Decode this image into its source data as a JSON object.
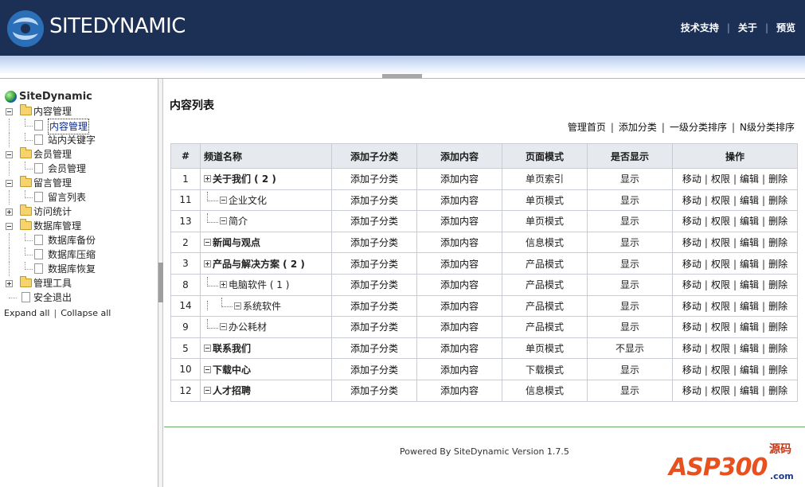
{
  "header": {
    "brand": "SITEDYNAMIC",
    "nav": [
      "技术支持",
      "关于",
      "预览"
    ]
  },
  "sidebar": {
    "root": "SiteDynamic",
    "items": [
      {
        "label": "内容管理",
        "type": "folder",
        "expanded": true,
        "level": 1
      },
      {
        "label": "内容管理",
        "type": "doc",
        "level": 2,
        "selected": true
      },
      {
        "label": "站内关键字",
        "type": "doc",
        "level": 2
      },
      {
        "label": "会员管理",
        "type": "folder",
        "expanded": true,
        "level": 1
      },
      {
        "label": "会员管理",
        "type": "doc",
        "level": 2
      },
      {
        "label": "留言管理",
        "type": "folder",
        "expanded": true,
        "level": 1
      },
      {
        "label": "留言列表",
        "type": "doc",
        "level": 2
      },
      {
        "label": "访问统计",
        "type": "folder",
        "expanded": false,
        "level": 1
      },
      {
        "label": "数据库管理",
        "type": "folder",
        "expanded": true,
        "level": 1
      },
      {
        "label": "数据库备份",
        "type": "doc",
        "level": 2
      },
      {
        "label": "数据库压缩",
        "type": "doc",
        "level": 2
      },
      {
        "label": "数据库恢复",
        "type": "doc",
        "level": 2
      },
      {
        "label": "管理工具",
        "type": "folder",
        "expanded": false,
        "level": 1
      },
      {
        "label": "安全退出",
        "type": "doc",
        "level": 1
      }
    ],
    "expand_all": "Expand all",
    "collapse_all": "Collapse all"
  },
  "main": {
    "title": "内容列表",
    "actions": [
      "管理首页",
      "添加分类",
      "一级分类排序",
      "N级分类排序"
    ],
    "columns": [
      "#",
      "频道名称",
      "添加子分类",
      "添加内容",
      "页面模式",
      "是否显示",
      "操作"
    ],
    "op_labels": [
      "移动",
      "权限",
      "编辑",
      "删除"
    ],
    "rows": [
      {
        "id": "1",
        "name": "关于我们 ( 2 )",
        "depth": 0,
        "toggle": "plus",
        "bold": true,
        "add_sub": "添加子分类",
        "add_content": "添加内容",
        "mode": "单页索引",
        "show": "显示"
      },
      {
        "id": "11",
        "name": "企业文化",
        "depth": 1,
        "toggle": "minus",
        "bold": false,
        "add_sub": "添加子分类",
        "add_content": "添加内容",
        "mode": "单页模式",
        "show": "显示"
      },
      {
        "id": "13",
        "name": "简介",
        "depth": 1,
        "toggle": "minus",
        "bold": false,
        "add_sub": "添加子分类",
        "add_content": "添加内容",
        "mode": "单页模式",
        "show": "显示"
      },
      {
        "id": "2",
        "name": "新闻与观点",
        "depth": 0,
        "toggle": "minus",
        "bold": true,
        "add_sub": "添加子分类",
        "add_content": "添加内容",
        "mode": "信息模式",
        "show": "显示"
      },
      {
        "id": "3",
        "name": "产品与解决方案 ( 2 )",
        "depth": 0,
        "toggle": "plus",
        "bold": true,
        "add_sub": "添加子分类",
        "add_content": "添加内容",
        "mode": "产品模式",
        "show": "显示"
      },
      {
        "id": "8",
        "name": "电脑软件 ( 1 )",
        "depth": 1,
        "toggle": "plus",
        "bold": false,
        "add_sub": "添加子分类",
        "add_content": "添加内容",
        "mode": "产品模式",
        "show": "显示"
      },
      {
        "id": "14",
        "name": "系统软件",
        "depth": 2,
        "toggle": "minus",
        "bold": false,
        "add_sub": "添加子分类",
        "add_content": "添加内容",
        "mode": "产品模式",
        "show": "显示"
      },
      {
        "id": "9",
        "name": "办公耗材",
        "depth": 1,
        "toggle": "minus",
        "bold": false,
        "add_sub": "添加子分类",
        "add_content": "添加内容",
        "mode": "产品模式",
        "show": "显示"
      },
      {
        "id": "5",
        "name": "联系我们",
        "depth": 0,
        "toggle": "minus",
        "bold": true,
        "add_sub": "添加子分类",
        "add_content": "添加内容",
        "mode": "单页模式",
        "show": "不显示"
      },
      {
        "id": "10",
        "name": "下载中心",
        "depth": 0,
        "toggle": "minus",
        "bold": true,
        "add_sub": "添加子分类",
        "add_content": "添加内容",
        "mode": "下载模式",
        "show": "显示"
      },
      {
        "id": "12",
        "name": "人才招聘",
        "depth": 0,
        "toggle": "minus",
        "bold": true,
        "add_sub": "添加子分类",
        "add_content": "添加内容",
        "mode": "信息模式",
        "show": "显示"
      }
    ],
    "footer": "Powered By SiteDynamic Version 1.7.5"
  },
  "watermark": {
    "text": "ASP300",
    "cn": "源码",
    "com": ".com"
  },
  "colors": {
    "header_bg": "#1c3055",
    "table_header_bg": "#e6eaef",
    "footer_line": "#6da86d"
  }
}
